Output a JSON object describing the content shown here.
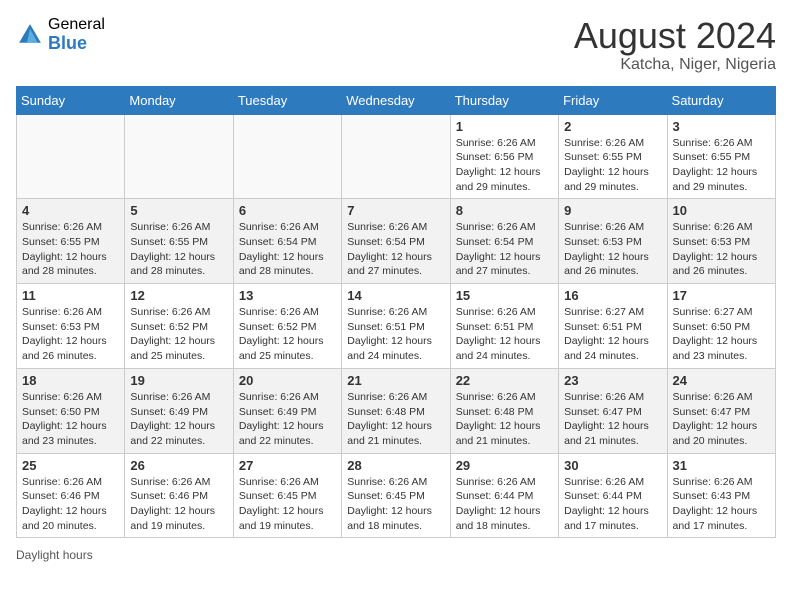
{
  "header": {
    "logo_general": "General",
    "logo_blue": "Blue",
    "month_year": "August 2024",
    "location": "Katcha, Niger, Nigeria"
  },
  "calendar": {
    "days_of_week": [
      "Sunday",
      "Monday",
      "Tuesday",
      "Wednesday",
      "Thursday",
      "Friday",
      "Saturday"
    ],
    "weeks": [
      [
        {
          "day": "",
          "detail": ""
        },
        {
          "day": "",
          "detail": ""
        },
        {
          "day": "",
          "detail": ""
        },
        {
          "day": "",
          "detail": ""
        },
        {
          "day": "1",
          "detail": "Sunrise: 6:26 AM\nSunset: 6:56 PM\nDaylight: 12 hours\nand 29 minutes."
        },
        {
          "day": "2",
          "detail": "Sunrise: 6:26 AM\nSunset: 6:55 PM\nDaylight: 12 hours\nand 29 minutes."
        },
        {
          "day": "3",
          "detail": "Sunrise: 6:26 AM\nSunset: 6:55 PM\nDaylight: 12 hours\nand 29 minutes."
        }
      ],
      [
        {
          "day": "4",
          "detail": "Sunrise: 6:26 AM\nSunset: 6:55 PM\nDaylight: 12 hours\nand 28 minutes."
        },
        {
          "day": "5",
          "detail": "Sunrise: 6:26 AM\nSunset: 6:55 PM\nDaylight: 12 hours\nand 28 minutes."
        },
        {
          "day": "6",
          "detail": "Sunrise: 6:26 AM\nSunset: 6:54 PM\nDaylight: 12 hours\nand 28 minutes."
        },
        {
          "day": "7",
          "detail": "Sunrise: 6:26 AM\nSunset: 6:54 PM\nDaylight: 12 hours\nand 27 minutes."
        },
        {
          "day": "8",
          "detail": "Sunrise: 6:26 AM\nSunset: 6:54 PM\nDaylight: 12 hours\nand 27 minutes."
        },
        {
          "day": "9",
          "detail": "Sunrise: 6:26 AM\nSunset: 6:53 PM\nDaylight: 12 hours\nand 26 minutes."
        },
        {
          "day": "10",
          "detail": "Sunrise: 6:26 AM\nSunset: 6:53 PM\nDaylight: 12 hours\nand 26 minutes."
        }
      ],
      [
        {
          "day": "11",
          "detail": "Sunrise: 6:26 AM\nSunset: 6:53 PM\nDaylight: 12 hours\nand 26 minutes."
        },
        {
          "day": "12",
          "detail": "Sunrise: 6:26 AM\nSunset: 6:52 PM\nDaylight: 12 hours\nand 25 minutes."
        },
        {
          "day": "13",
          "detail": "Sunrise: 6:26 AM\nSunset: 6:52 PM\nDaylight: 12 hours\nand 25 minutes."
        },
        {
          "day": "14",
          "detail": "Sunrise: 6:26 AM\nSunset: 6:51 PM\nDaylight: 12 hours\nand 24 minutes."
        },
        {
          "day": "15",
          "detail": "Sunrise: 6:26 AM\nSunset: 6:51 PM\nDaylight: 12 hours\nand 24 minutes."
        },
        {
          "day": "16",
          "detail": "Sunrise: 6:27 AM\nSunset: 6:51 PM\nDaylight: 12 hours\nand 24 minutes."
        },
        {
          "day": "17",
          "detail": "Sunrise: 6:27 AM\nSunset: 6:50 PM\nDaylight: 12 hours\nand 23 minutes."
        }
      ],
      [
        {
          "day": "18",
          "detail": "Sunrise: 6:26 AM\nSunset: 6:50 PM\nDaylight: 12 hours\nand 23 minutes."
        },
        {
          "day": "19",
          "detail": "Sunrise: 6:26 AM\nSunset: 6:49 PM\nDaylight: 12 hours\nand 22 minutes."
        },
        {
          "day": "20",
          "detail": "Sunrise: 6:26 AM\nSunset: 6:49 PM\nDaylight: 12 hours\nand 22 minutes."
        },
        {
          "day": "21",
          "detail": "Sunrise: 6:26 AM\nSunset: 6:48 PM\nDaylight: 12 hours\nand 21 minutes."
        },
        {
          "day": "22",
          "detail": "Sunrise: 6:26 AM\nSunset: 6:48 PM\nDaylight: 12 hours\nand 21 minutes."
        },
        {
          "day": "23",
          "detail": "Sunrise: 6:26 AM\nSunset: 6:47 PM\nDaylight: 12 hours\nand 21 minutes."
        },
        {
          "day": "24",
          "detail": "Sunrise: 6:26 AM\nSunset: 6:47 PM\nDaylight: 12 hours\nand 20 minutes."
        }
      ],
      [
        {
          "day": "25",
          "detail": "Sunrise: 6:26 AM\nSunset: 6:46 PM\nDaylight: 12 hours\nand 20 minutes."
        },
        {
          "day": "26",
          "detail": "Sunrise: 6:26 AM\nSunset: 6:46 PM\nDaylight: 12 hours\nand 19 minutes."
        },
        {
          "day": "27",
          "detail": "Sunrise: 6:26 AM\nSunset: 6:45 PM\nDaylight: 12 hours\nand 19 minutes."
        },
        {
          "day": "28",
          "detail": "Sunrise: 6:26 AM\nSunset: 6:45 PM\nDaylight: 12 hours\nand 18 minutes."
        },
        {
          "day": "29",
          "detail": "Sunrise: 6:26 AM\nSunset: 6:44 PM\nDaylight: 12 hours\nand 18 minutes."
        },
        {
          "day": "30",
          "detail": "Sunrise: 6:26 AM\nSunset: 6:44 PM\nDaylight: 12 hours\nand 17 minutes."
        },
        {
          "day": "31",
          "detail": "Sunrise: 6:26 AM\nSunset: 6:43 PM\nDaylight: 12 hours\nand 17 minutes."
        }
      ]
    ]
  },
  "footer": {
    "daylight_label": "Daylight hours"
  }
}
